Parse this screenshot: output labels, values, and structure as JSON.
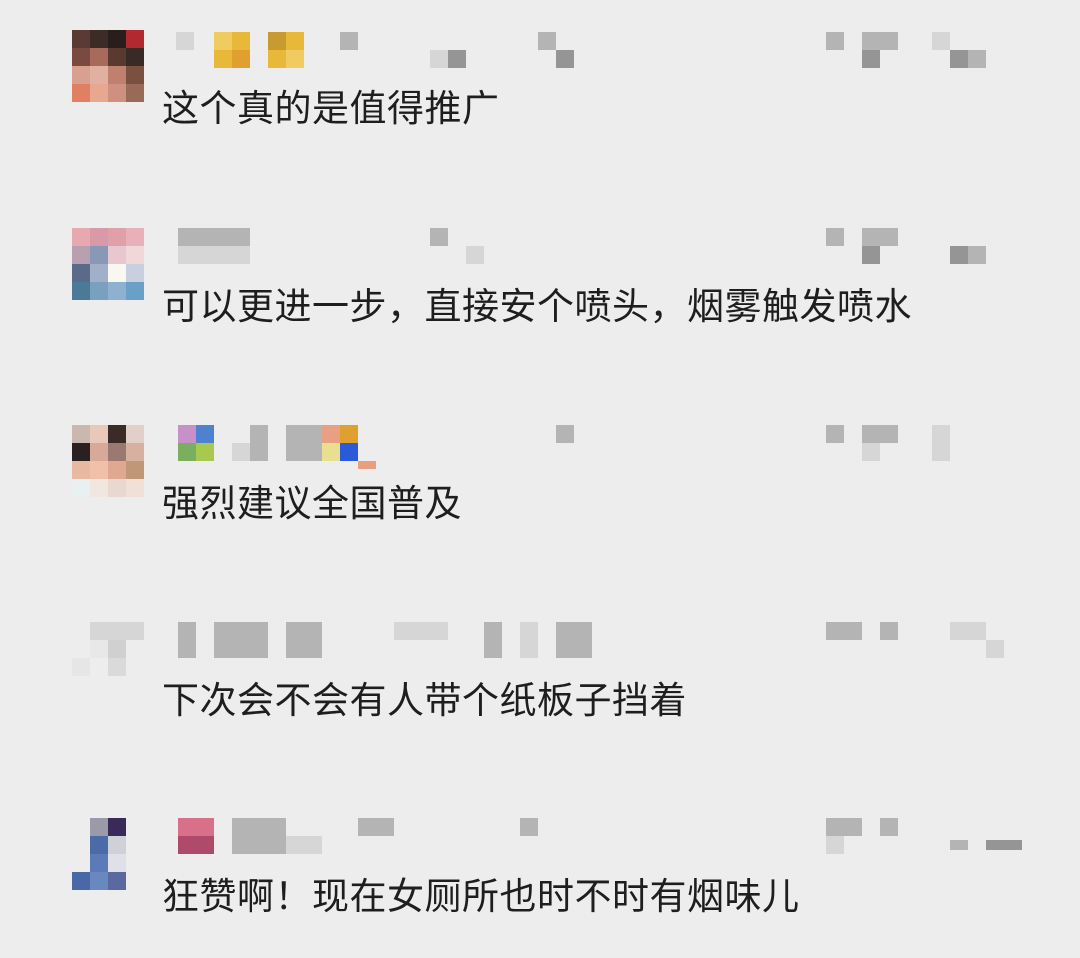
{
  "comments": [
    {
      "text": "这个真的是值得推广",
      "avatar": [
        "#5a3a35",
        "#3d2b28",
        "#2a1e1c",
        "#b22a30",
        "#7a4a40",
        "#a86a5a",
        "#5a3a30",
        "#3a2a25",
        "#d9a090",
        "#e0b0a0",
        "#c08070",
        "#7a5040",
        "#e08060",
        "#e8a890",
        "#d09080",
        "#9a6a58"
      ]
    },
    {
      "text": "可以更进一步，直接安个喷头，烟雾触发喷水",
      "avatar": [
        "#e8a8b0",
        "#d89aa8",
        "#e0a0a8",
        "#e8b0b8",
        "#b8a0b0",
        "#8a98b8",
        "#e8c8d0",
        "#f0d8d8",
        "#5a6a88",
        "#a0b0c8",
        "#f8f8f0",
        "#c8d0e0",
        "#4a7a98",
        "#7aa0c0",
        "#90b0d0",
        "#6aa0c8"
      ]
    },
    {
      "text": "强烈建议全国普及",
      "avatar": [
        "#c8b8b0",
        "#e8c8b8",
        "#3a2a28",
        "#e0d0c8",
        "#2a2020",
        "#d8a898",
        "#9a7a70",
        "#d8b0a0",
        "#e8b8a0",
        "#f0c0a8",
        "#e0a890",
        "#c09878",
        "#e8f0f0",
        "#f0e8e0",
        "#e8d8d0",
        "#f0e0d8"
      ]
    },
    {
      "text": "下次会不会有人带个纸板子挡着",
      "avatar": [
        "#ededed",
        "#e4e4e4",
        "#d8d8d8",
        "#ededed",
        "#ededed",
        "#e8e8e8",
        "#d0d0d0",
        "#ededed",
        "#e6e6e6",
        "#ededed",
        "#dadada",
        "#ededed",
        "#ededed",
        "#ededed",
        "#ededed",
        "#ededed"
      ]
    },
    {
      "text": "狂赞啊！现在女厕所也时不时有烟味儿",
      "avatar": [
        "#ededed",
        "#9a9aa8",
        "#3a2a5a",
        "#ededed",
        "#ededed",
        "#4a6aa8",
        "#d0d0d8",
        "#ededed",
        "#ededed",
        "#5a7ab8",
        "#e0e0e8",
        "#ededed",
        "#4a68a8",
        "#6a88c0",
        "#5a6aa0",
        "#ededed"
      ]
    }
  ],
  "redaction_colors": {
    "light": "#d6d6d6",
    "mid": "#b4b4b4",
    "dark": "#959595",
    "yellow": "#e8b838",
    "yellow_light": "#f0cc60",
    "gold": "#c89a30",
    "pink": "#d8708a",
    "magenta": "#b04a6a",
    "lilac": "#c890c8",
    "blue": "#5080d0",
    "green": "#78b060",
    "lime": "#a8c850",
    "salmon": "#e8a080",
    "orange": "#e0a030",
    "royal": "#2a5ad8",
    "khaki": "#e8e090"
  }
}
